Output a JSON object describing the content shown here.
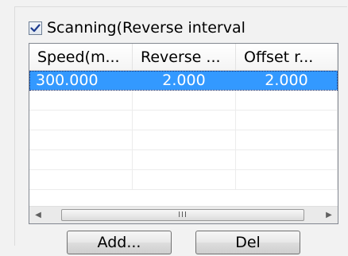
{
  "checkbox": {
    "label": "Scanning(Reverse interval",
    "checked": true
  },
  "table": {
    "columns": [
      "Speed(m...",
      "Reverse ...",
      "Offset r..."
    ],
    "rows": [
      [
        "300.000",
        "2.000",
        "2.000"
      ],
      [
        "",
        "",
        ""
      ],
      [
        "",
        "",
        ""
      ],
      [
        "",
        "",
        ""
      ],
      [
        "",
        "",
        ""
      ],
      [
        "",
        "",
        ""
      ]
    ],
    "selected_row": 0
  },
  "scrollbar": {
    "grip": "III"
  },
  "buttons": {
    "add_label": "Add...",
    "del_label": "Del"
  }
}
